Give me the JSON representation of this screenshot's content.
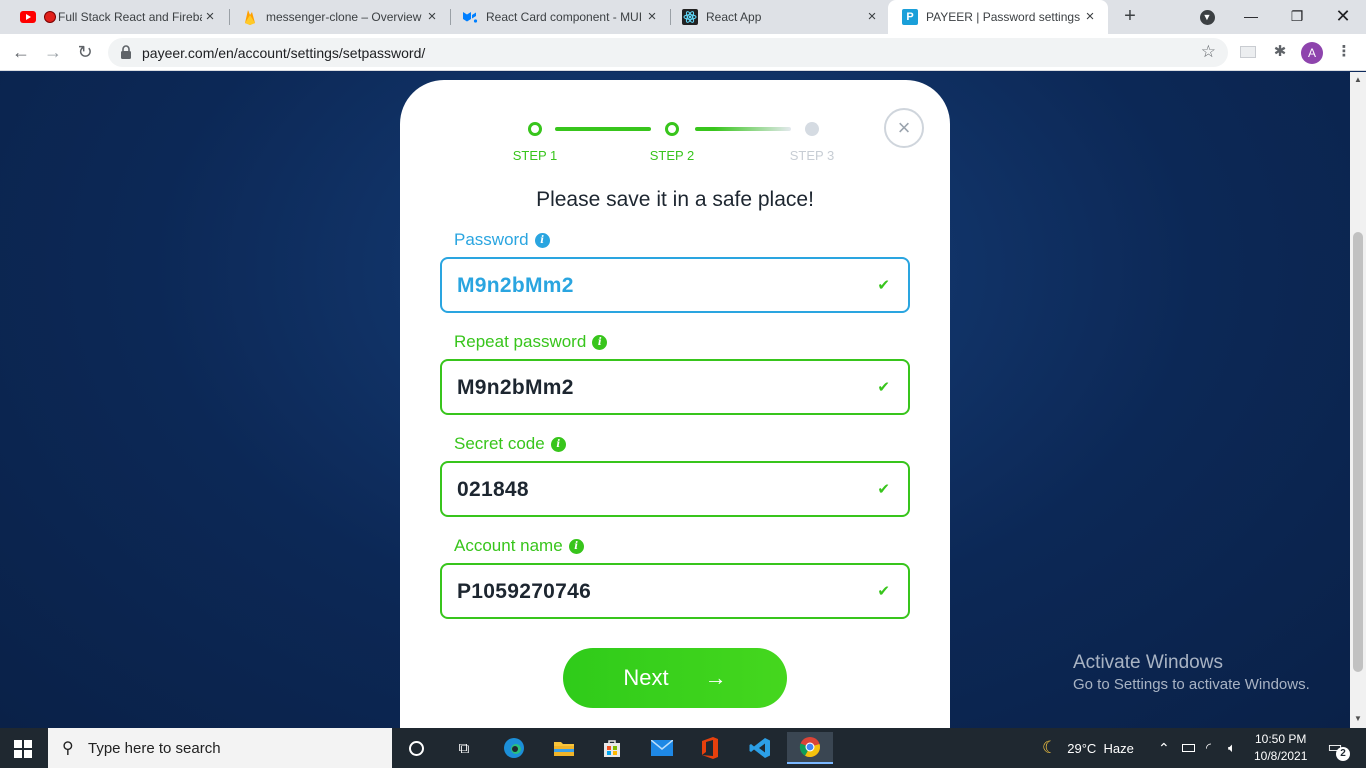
{
  "browser": {
    "tabs": [
      {
        "title": "Full Stack React and Fireba",
        "icon": "youtube-icon"
      },
      {
        "title": "messenger-clone – Overview",
        "icon": "firebase-icon"
      },
      {
        "title": "React Card component - MUI",
        "icon": "mui-icon"
      },
      {
        "title": "React App",
        "icon": "react-icon"
      },
      {
        "title": "PAYEER | Password settings",
        "icon": "payeer-icon",
        "favicon_letter": "P"
      }
    ],
    "url": "payeer.com/en/account/settings/setpassword/",
    "profile_initial": "A"
  },
  "stepper": {
    "steps": [
      "STEP 1",
      "STEP 2",
      "STEP 3"
    ],
    "current": 2
  },
  "form": {
    "headline": "Please save it in a safe place!",
    "fields": [
      {
        "label": "Password",
        "value": "M9n2bMm2"
      },
      {
        "label": "Repeat password",
        "value": "M9n2bMm2"
      },
      {
        "label": "Secret code",
        "value": "021848"
      },
      {
        "label": "Account name",
        "value": "P1059270746"
      }
    ],
    "info_glyph": "i",
    "next_label": "Next"
  },
  "watermark": {
    "line1": "Activate Windows",
    "line2": "Go to Settings to activate Windows."
  },
  "taskbar": {
    "search_placeholder": "Type here to search",
    "weather": "29°C  Haze",
    "time": "10:50 PM",
    "date": "10/8/2021",
    "notification_count": "2"
  },
  "colors": {
    "accent_green": "#38c51c",
    "accent_blue": "#2aa5e0",
    "page_bg": "#0d2a5c"
  }
}
